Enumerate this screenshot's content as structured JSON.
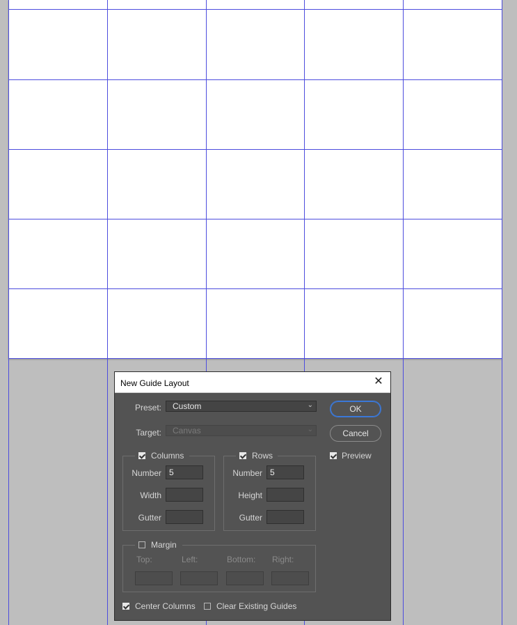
{
  "dialog": {
    "title": "New Guide Layout",
    "close_glyph": "✕",
    "preset": {
      "label": "Preset:",
      "value": "Custom"
    },
    "target": {
      "label": "Target:",
      "value": "Canvas"
    },
    "ok_label": "OK",
    "cancel_label": "Cancel",
    "preview": {
      "label": "Preview",
      "checked": true
    },
    "columns": {
      "label": "Columns",
      "checked": true,
      "number_label": "Number",
      "number_value": "5",
      "width_label": "Width",
      "width_value": "",
      "gutter_label": "Gutter",
      "gutter_value": ""
    },
    "rows": {
      "label": "Rows",
      "checked": true,
      "number_label": "Number",
      "number_value": "5",
      "height_label": "Height",
      "height_value": "",
      "gutter_label": "Gutter",
      "gutter_value": ""
    },
    "margin": {
      "label": "Margin",
      "checked": false,
      "top_label": "Top:",
      "left_label": "Left:",
      "bottom_label": "Bottom:",
      "right_label": "Right:",
      "top_value": "",
      "left_value": "",
      "bottom_value": "",
      "right_value": ""
    },
    "center_columns": {
      "label": "Center Columns",
      "checked": true
    },
    "clear_guides": {
      "label": "Clear Existing Guides",
      "checked": false
    }
  },
  "colors": {
    "guide": "#4c4cde",
    "pasteboard": "#bebebe",
    "dialog_bg": "#535353",
    "default_button_border": "#3b78d8"
  }
}
